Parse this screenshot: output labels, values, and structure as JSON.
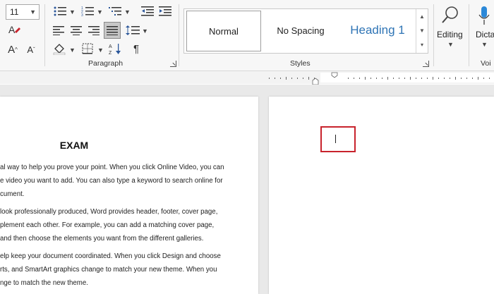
{
  "font": {
    "size_value": "11"
  },
  "paragraph": {
    "group_label": "Paragraph",
    "show_marks_glyph": "¶"
  },
  "styles": {
    "group_label": "Styles",
    "items": [
      {
        "label": "Normal",
        "selected": true
      },
      {
        "label": "No Spacing",
        "selected": false
      },
      {
        "label": "Heading 1",
        "selected": false
      }
    ]
  },
  "editing": {
    "label": "Editing"
  },
  "voice": {
    "dictate_label": "Dicta",
    "group_label": "Voi"
  },
  "colors": {
    "accent_red": "#c8232c",
    "heading_blue": "#2e74b5",
    "selected_button_bg": "#c8c8c8"
  },
  "document": {
    "title": "EXAM",
    "lines": [
      "al way to help you prove your point. When you click Online Video, you can",
      "e video you want to add. You can also type a keyword to search online for",
      "cument.",
      "look professionally produced, Word provides header, footer, cover page,",
      "plement each other. For example, you can add a matching cover page,",
      " and then choose the elements you want from the different galleries.",
      "elp keep your document coordinated. When you click Design and choose",
      "rts, and SmartArt graphics change to match your new theme. When you",
      "nge to match the new theme."
    ]
  }
}
